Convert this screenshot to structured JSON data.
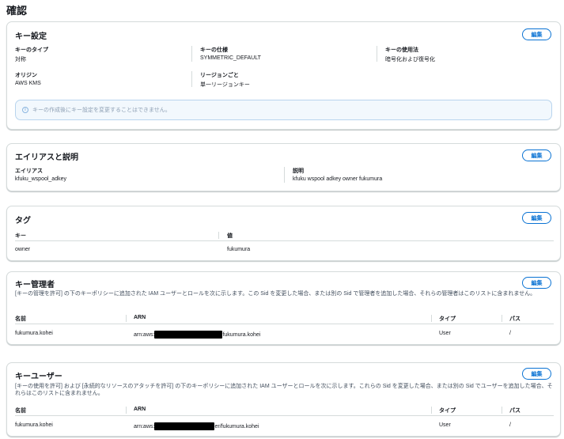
{
  "page_title": "確認",
  "edit_label": "編集",
  "key_settings": {
    "title": "キー設定",
    "key_type_label": "キーのタイプ",
    "key_type_value": "対称",
    "key_spec_label": "キーの仕様",
    "key_spec_value": "SYMMETRIC_DEFAULT",
    "key_usage_label": "キーの使用法",
    "key_usage_value": "暗号化および復号化",
    "origin_label": "オリジン",
    "origin_value": "AWS KMS",
    "regionality_label": "リージョンごと",
    "regionality_value": "単一リージョンキー",
    "info_text": "キーの作成後にキー設定を変更することはできません。"
  },
  "alias": {
    "title": "エイリアスと説明",
    "alias_label": "エイリアス",
    "alias_value": "kfuku_wspool_adkey",
    "description_label": "説明",
    "description_value": "kfuku wspool adkey owner fukumura"
  },
  "tags": {
    "title": "タグ",
    "col_key": "キー",
    "col_value": "値",
    "rows": [
      {
        "key": "owner",
        "value": "fukumura"
      }
    ]
  },
  "key_admins": {
    "title": "キー管理者",
    "description": "[キーの管理を許可] の下のキーポリシーに追加された IAM ユーザーとロールを次に示します。この Sid を変更した場合、または別の Sid で管理者を追加した場合、それらの管理者はこのリストに含まれません。",
    "col_name": "名前",
    "col_arn": "ARN",
    "col_type": "タイプ",
    "col_path": "パス",
    "rows": [
      {
        "name": "fukumura.kohei",
        "arn_prefix": "arn:aws:",
        "arn_suffix": "fukumura.kohei",
        "type": "User",
        "path": "/"
      }
    ]
  },
  "key_users": {
    "title": "キーユーザー",
    "description": "[キーの使用を許可] および [永続的なリソースのアタッチを許可] の下のキーポリシーに追加された IAM ユーザーとロールを次に示します。これらの Sid を変更した場合、または別の Sid でユーザーを追加した場合、それらはこのリストに含まれません。",
    "col_name": "名前",
    "col_arn": "ARN",
    "col_type": "タイプ",
    "col_path": "パス",
    "rows": [
      {
        "name": "fukumura.kohei",
        "arn_prefix": "arn:aws:",
        "arn_suffix": "er/fukumura.kohei",
        "type": "User",
        "path": "/"
      }
    ]
  }
}
